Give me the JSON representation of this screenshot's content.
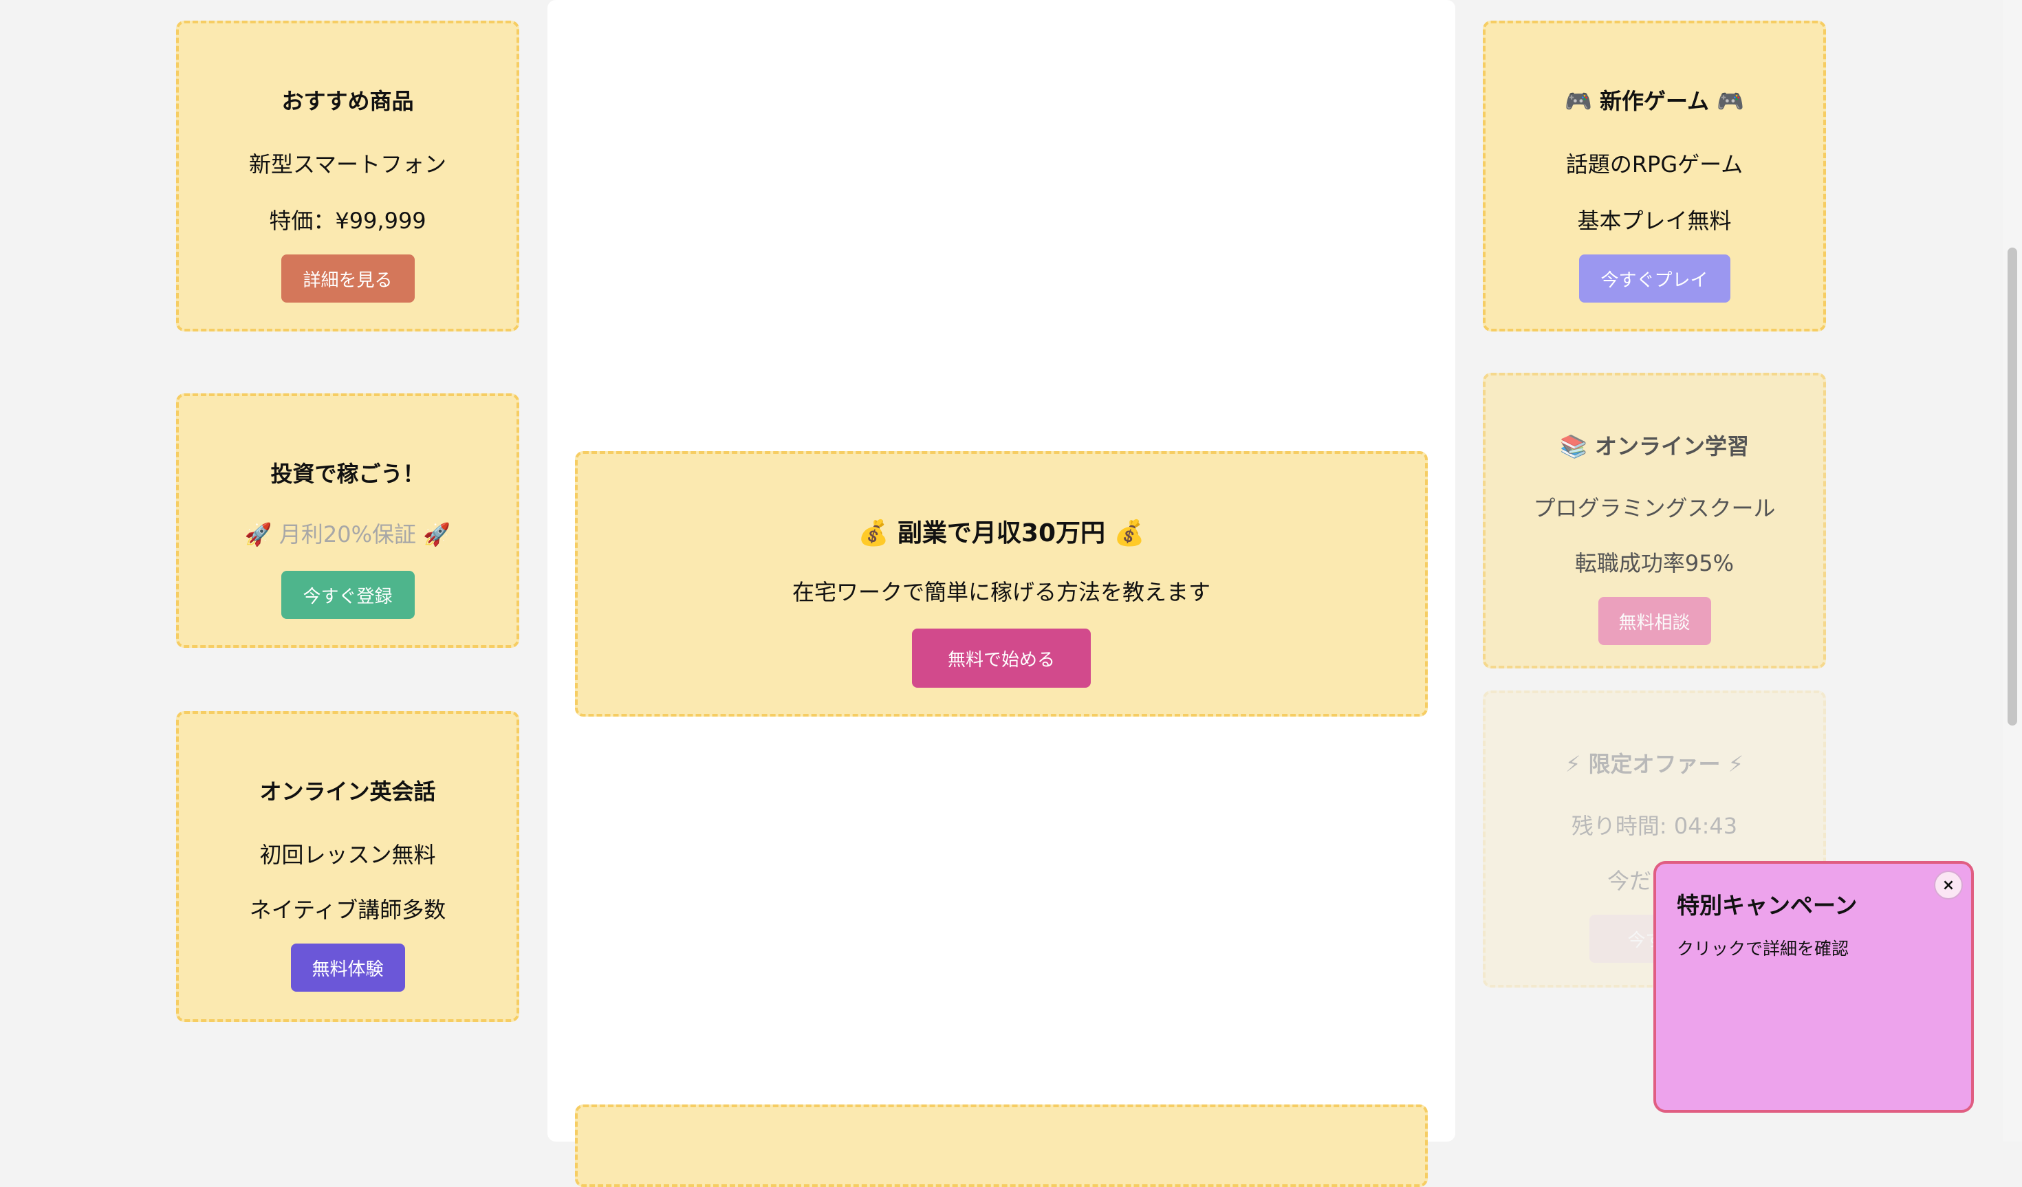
{
  "left_ads": [
    {
      "title": "おすすめ商品",
      "line1": "新型スマートフォン",
      "line2": "特価：¥99,999",
      "button": "詳細を見る"
    },
    {
      "title": "投資で稼ごう！",
      "line1": "🚀 月利20%保証 🚀",
      "button": "今すぐ登録"
    },
    {
      "title": "オンライン英会話",
      "line1": "初回レッスン無料",
      "line2": "ネイティブ講師多数",
      "button": "無料体験"
    }
  ],
  "center_ad": {
    "title": "💰 副業で月収30万円 💰",
    "text": "在宅ワークで簡単に稼げる方法を教えます",
    "button": "無料で始める"
  },
  "right_ads": [
    {
      "title": "🎮 新作ゲーム 🎮",
      "line1": "話題のRPGゲーム",
      "line2": "基本プレイ無料",
      "button": "今すぐプレイ"
    },
    {
      "title": "📚 オンライン学習",
      "line1": "プログラミングスクール",
      "line2": "転職成功率95%",
      "button": "無料相談"
    },
    {
      "title": "⚡ 限定オファー ⚡",
      "line1": "残り時間: 04:43",
      "line2": "今だけ90",
      "button": "今すぐ"
    }
  ],
  "popup": {
    "title": "特別キャンペーン",
    "text": "クリックで詳細を確認",
    "close": "×"
  },
  "colors": {
    "ad_bg": "#fbe9b0",
    "ad_border": "#f6cd63",
    "btn_detail": "#d4775a",
    "btn_register": "#4eb58c",
    "btn_trial": "#6b57d8",
    "btn_start": "#d24a8c",
    "btn_play": "#9b97f0",
    "btn_consult": "#e97ea7",
    "btn_offer": "#eac4bd",
    "popup_bg": "#eda3ec",
    "popup_border": "#e05d82"
  }
}
